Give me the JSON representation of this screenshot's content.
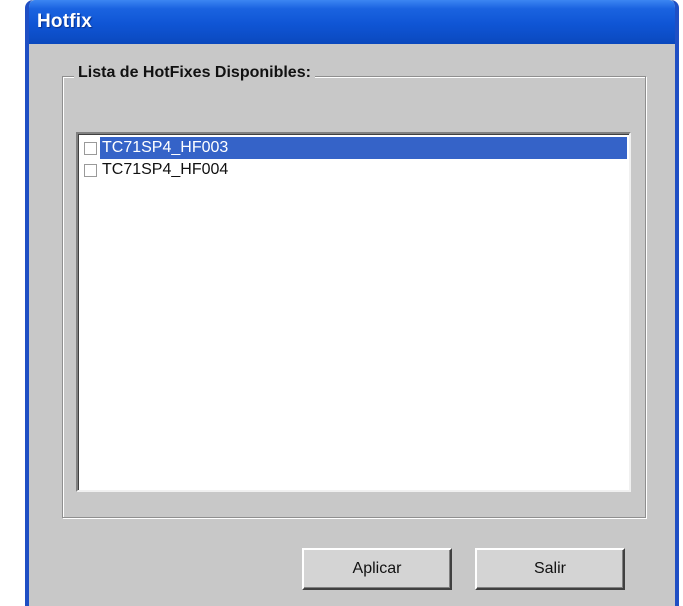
{
  "window": {
    "title": "Hotfix"
  },
  "group": {
    "label": "Lista de HotFixes Disponibles:"
  },
  "hotfix_list": {
    "items": [
      {
        "label": "TC71SP4_HF003",
        "checked": false,
        "selected": true
      },
      {
        "label": "TC71SP4_HF004",
        "checked": false,
        "selected": false
      }
    ]
  },
  "buttons": {
    "apply_label": "Aplicar",
    "exit_label": "Salir"
  },
  "colors": {
    "titlebar": "#0f55d5",
    "selection": "#3563c8",
    "dialog_background": "#c8c8c8"
  }
}
